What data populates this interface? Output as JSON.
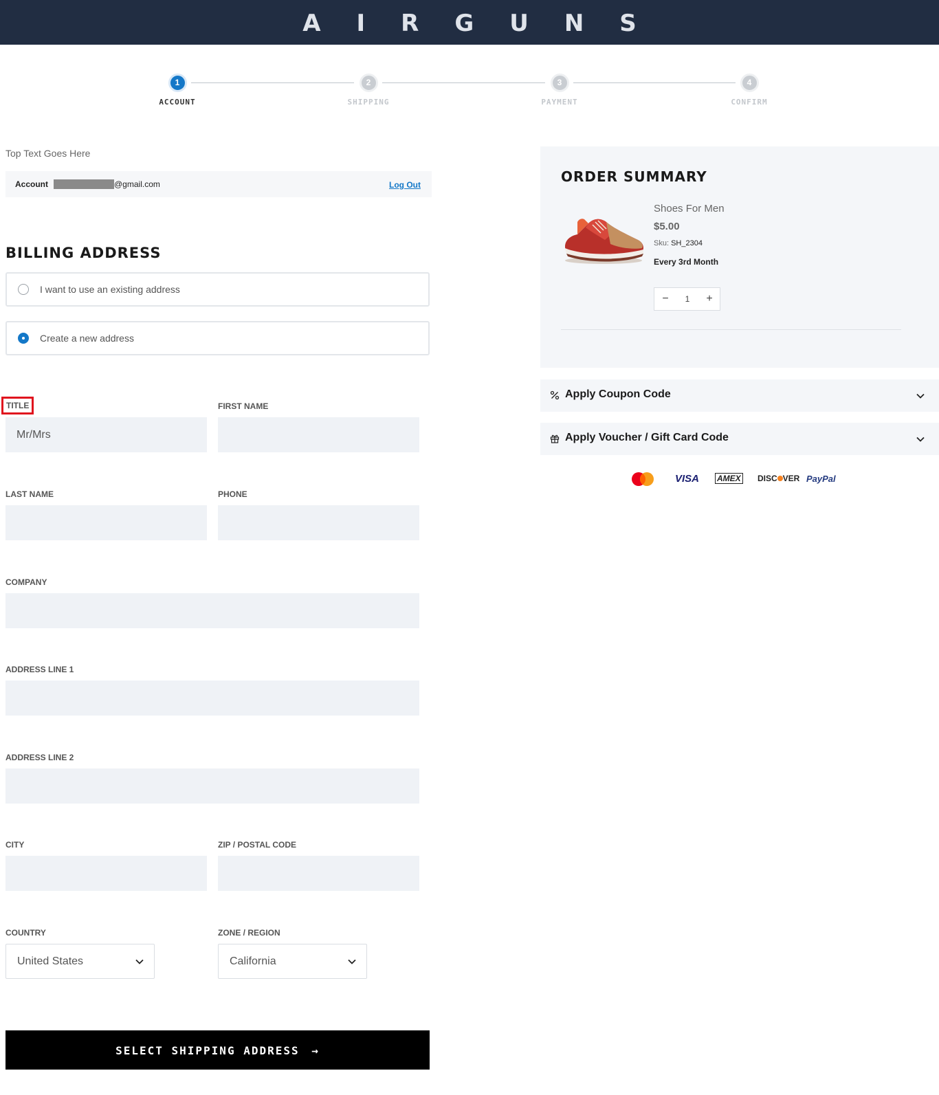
{
  "brand": {
    "logo_text": "AIRGUNS"
  },
  "stepper": {
    "steps": [
      {
        "number": "1",
        "label": "ACCOUNT"
      },
      {
        "number": "2",
        "label": "SHIPPING"
      },
      {
        "number": "3",
        "label": "PAYMENT"
      },
      {
        "number": "4",
        "label": "CONFIRM"
      }
    ],
    "active_step": "1"
  },
  "account": {
    "top_text": "Top Text Goes Here",
    "label": "Account",
    "email_suffix": "@gmail.com",
    "logout_label": "Log Out"
  },
  "billing": {
    "title": "BILLING ADDRESS",
    "options": [
      {
        "label": "I want to use an existing address",
        "selected": false
      },
      {
        "label": "Create a new address",
        "selected": true
      }
    ],
    "fields": {
      "title": {
        "label": "TITLE",
        "placeholder": "Mr/Mrs"
      },
      "first_name": {
        "label": "FIRST NAME",
        "placeholder": ""
      },
      "last_name": {
        "label": "LAST NAME",
        "placeholder": ""
      },
      "phone": {
        "label": "PHONE",
        "placeholder": ""
      },
      "company": {
        "label": "COMPANY",
        "placeholder": ""
      },
      "address1": {
        "label": "ADDRESS LINE 1",
        "placeholder": ""
      },
      "address2": {
        "label": "ADDRESS LINE 2",
        "placeholder": ""
      },
      "city": {
        "label": "CITY",
        "placeholder": ""
      },
      "zip": {
        "label": "ZIP / POSTAL CODE",
        "placeholder": ""
      },
      "country": {
        "label": "COUNTRY",
        "value": "United States"
      },
      "zone": {
        "label": "ZONE / REGION",
        "value": "California"
      }
    },
    "submit_label": "SELECT SHIPPING ADDRESS",
    "submit_arrow": "→"
  },
  "summary": {
    "title": "ORDER SUMMARY",
    "product": {
      "name": "Shoes For Men",
      "price": "$5.00",
      "sku_label": "Sku:",
      "sku_value": "SH_2304",
      "frequency": "Every 3rd Month",
      "quantity": "1",
      "minus": "−",
      "plus": "+"
    },
    "coupon_label": "Apply Coupon Code",
    "voucher_label": "Apply Voucher / Gift Card Code"
  },
  "payment_methods": {
    "visa": "VISA",
    "amex": "AMEX",
    "discover_pre": "DISC",
    "discover_post": "VER",
    "paypal": "PayPal"
  },
  "colors": {
    "header_bg": "#212d42",
    "accent": "#1478c8",
    "highlight": "#e0141e"
  }
}
